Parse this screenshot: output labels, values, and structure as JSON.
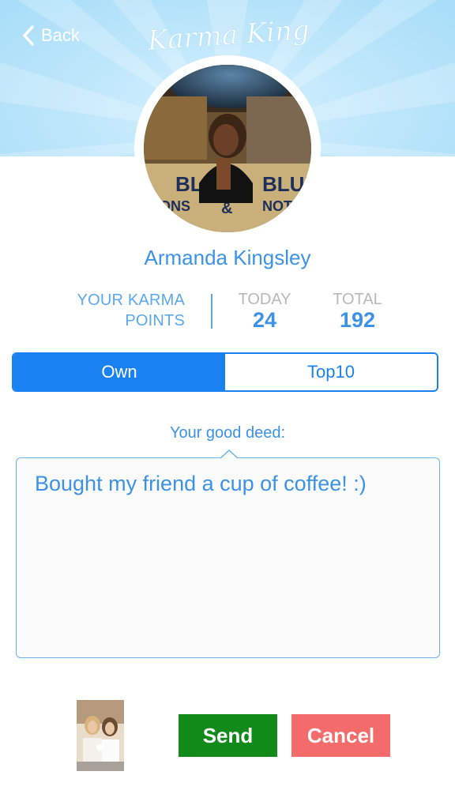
{
  "header": {
    "back_label": "Back",
    "logo_text": "Karma King"
  },
  "profile": {
    "name": "Armanda Kingsley",
    "avatar_icon": "profile-photo"
  },
  "karma": {
    "label_line1": "YOUR KARMA",
    "label_line2": "POINTS",
    "today_label": "TODAY",
    "today_value": "24",
    "total_label": "TOTAL",
    "total_value": "192"
  },
  "segments": {
    "own": "Own",
    "top10": "Top10",
    "selected": "Own"
  },
  "deed": {
    "label": "Your good deed:",
    "text": "Bought my friend a cup of coffee! :)"
  },
  "actions": {
    "send": "Send",
    "cancel": "Cancel"
  },
  "colors": {
    "accent": "#1a82f0",
    "text_blue": "#3b92e6",
    "send_green": "#118a19",
    "cancel_red": "#f46b6b"
  }
}
